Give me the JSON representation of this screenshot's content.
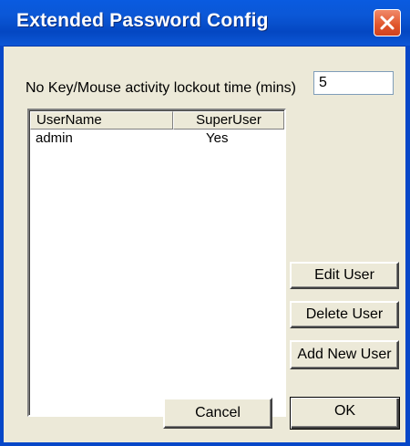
{
  "window": {
    "title": "Extended Password Config"
  },
  "lockout": {
    "label": "No Key/Mouse activity lockout time (mins)",
    "value": "5"
  },
  "user_table": {
    "columns": [
      "UserName",
      "SuperUser"
    ],
    "rows": [
      {
        "username": "admin",
        "superuser": "Yes"
      }
    ]
  },
  "buttons": {
    "edit_user": "Edit User",
    "delete_user": "Delete User",
    "add_new_user": "Add New User",
    "cancel": "Cancel",
    "ok": "OK"
  },
  "icons": {
    "close": "close-icon"
  },
  "colors": {
    "titlebar": "#0b57d6",
    "close_button": "#e0542b",
    "dialog_bg": "#ece9d8"
  }
}
